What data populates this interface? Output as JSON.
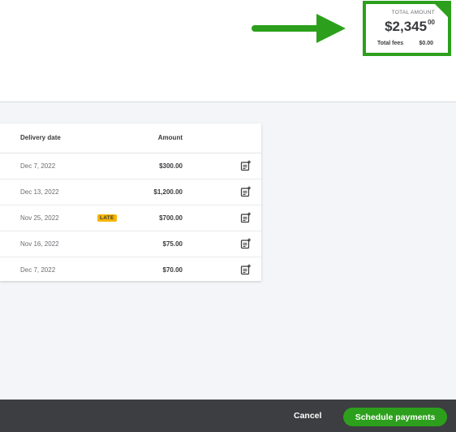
{
  "summary": {
    "total_label": "TOTAL AMOUNT",
    "total_whole": "$2,345",
    "total_cents": "00",
    "fees_label": "Total fees",
    "fees_value": "$0.00"
  },
  "table": {
    "columns": {
      "delivery_date": "Delivery date",
      "amount": "Amount"
    },
    "rows": [
      {
        "date": "Dec 7, 2022",
        "badge": "",
        "amount": "$300.00"
      },
      {
        "date": "Dec 13, 2022",
        "badge": "",
        "amount": "$1,200.00"
      },
      {
        "date": "Nov 25, 2022",
        "badge": "LATE",
        "amount": "$700.00"
      },
      {
        "date": "Nov 16, 2022",
        "badge": "",
        "amount": "$75.00"
      },
      {
        "date": "Dec 7, 2022",
        "badge": "",
        "amount": "$70.00"
      }
    ]
  },
  "footer": {
    "cancel_label": "Cancel",
    "schedule_label": "Schedule payments"
  },
  "colors": {
    "accent_green": "#2ca01c",
    "late_badge": "#f7b500",
    "footer_bg": "#3d3e41"
  },
  "icons": {
    "row_action": "add-memo-icon",
    "callout": "arrow-right-icon"
  }
}
